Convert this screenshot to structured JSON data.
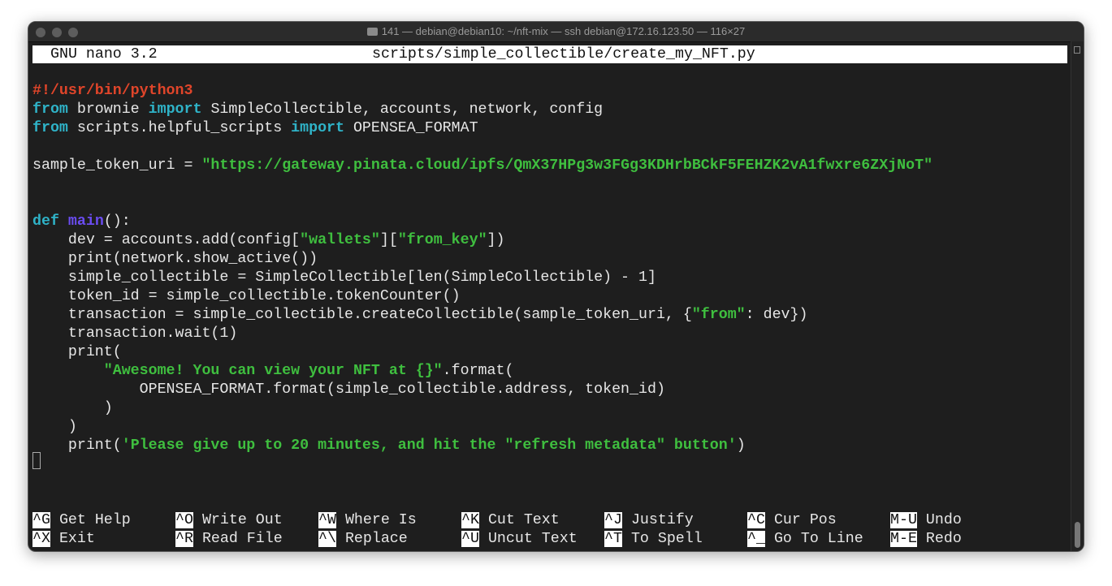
{
  "window": {
    "title": "141 — debian@debian10: ~/nft-mix — ssh debian@172.16.123.50 — 116×27"
  },
  "nano": {
    "version": "GNU nano 3.2",
    "filename": "scripts/simple_collectible/create_my_NFT.py"
  },
  "code": [
    {
      "row": 2,
      "segs": [
        {
          "t": "#!/usr/bin/python3",
          "c": "she"
        }
      ]
    },
    {
      "row": 3,
      "segs": [
        {
          "t": "from",
          "c": "kw"
        },
        {
          "t": " brownie ",
          "c": ""
        },
        {
          "t": "import",
          "c": "kw"
        },
        {
          "t": " SimpleCollectible, accounts, network, config",
          "c": ""
        }
      ]
    },
    {
      "row": 4,
      "segs": [
        {
          "t": "from",
          "c": "kw"
        },
        {
          "t": " scripts.helpful_scripts ",
          "c": ""
        },
        {
          "t": "import",
          "c": "kw"
        },
        {
          "t": " OPENSEA_FORMAT",
          "c": ""
        }
      ]
    },
    {
      "row": 6,
      "segs": [
        {
          "t": "sample_token_uri = ",
          "c": ""
        },
        {
          "t": "\"https://gateway.pinata.cloud/ipfs/QmX37HPg3w3FGg3KDHrbBCkF5FEHZK2vA1fwxre6ZXjNoT\"",
          "c": "str"
        }
      ]
    },
    {
      "row": 9,
      "segs": [
        {
          "t": "def",
          "c": "kw"
        },
        {
          "t": " ",
          "c": ""
        },
        {
          "t": "main",
          "c": "fn"
        },
        {
          "t": "():",
          "c": ""
        }
      ]
    },
    {
      "row": 10,
      "segs": [
        {
          "t": "    dev = accounts.add(config[",
          "c": ""
        },
        {
          "t": "\"wallets\"",
          "c": "str"
        },
        {
          "t": "][",
          "c": ""
        },
        {
          "t": "\"from_key\"",
          "c": "str"
        },
        {
          "t": "])",
          "c": ""
        }
      ]
    },
    {
      "row": 11,
      "segs": [
        {
          "t": "    print(network.show_active())",
          "c": ""
        }
      ]
    },
    {
      "row": 12,
      "segs": [
        {
          "t": "    simple_collectible = SimpleCollectible[len(SimpleCollectible) - 1]",
          "c": ""
        }
      ]
    },
    {
      "row": 13,
      "segs": [
        {
          "t": "    token_id = simple_collectible.tokenCounter()",
          "c": ""
        }
      ]
    },
    {
      "row": 14,
      "segs": [
        {
          "t": "    transaction = simple_collectible.createCollectible(sample_token_uri, {",
          "c": ""
        },
        {
          "t": "\"from\"",
          "c": "str"
        },
        {
          "t": ": dev})",
          "c": ""
        }
      ]
    },
    {
      "row": 15,
      "segs": [
        {
          "t": "    transaction.wait(1)",
          "c": ""
        }
      ]
    },
    {
      "row": 16,
      "segs": [
        {
          "t": "    print(",
          "c": ""
        }
      ]
    },
    {
      "row": 17,
      "segs": [
        {
          "t": "        ",
          "c": ""
        },
        {
          "t": "\"Awesome! You can view your NFT at {}\"",
          "c": "str"
        },
        {
          "t": ".format(",
          "c": ""
        }
      ]
    },
    {
      "row": 18,
      "segs": [
        {
          "t": "            OPENSEA_FORMAT.format(simple_collectible.address, token_id)",
          "c": ""
        }
      ]
    },
    {
      "row": 19,
      "segs": [
        {
          "t": "        )",
          "c": ""
        }
      ]
    },
    {
      "row": 20,
      "segs": [
        {
          "t": "    )",
          "c": ""
        }
      ]
    },
    {
      "row": 21,
      "segs": [
        {
          "t": "    print(",
          "c": ""
        },
        {
          "t": "'Please give up to 20 minutes, and hit the \"refresh metadata\" button'",
          "c": "str"
        },
        {
          "t": ")",
          "c": ""
        }
      ]
    }
  ],
  "shortcuts": [
    [
      {
        "key": "^G",
        "label": "Get Help"
      },
      {
        "key": "^O",
        "label": "Write Out"
      },
      {
        "key": "^W",
        "label": "Where Is"
      },
      {
        "key": "^K",
        "label": "Cut Text"
      },
      {
        "key": "^J",
        "label": "Justify"
      },
      {
        "key": "^C",
        "label": "Cur Pos"
      },
      {
        "key": "M-U",
        "label": "Undo"
      }
    ],
    [
      {
        "key": "^X",
        "label": "Exit"
      },
      {
        "key": "^R",
        "label": "Read File"
      },
      {
        "key": "^\\",
        "label": "Replace"
      },
      {
        "key": "^U",
        "label": "Uncut Text"
      },
      {
        "key": "^T",
        "label": "To Spell"
      },
      {
        "key": "^_",
        "label": "Go To Line"
      },
      {
        "key": "M-E",
        "label": "Redo"
      }
    ]
  ]
}
